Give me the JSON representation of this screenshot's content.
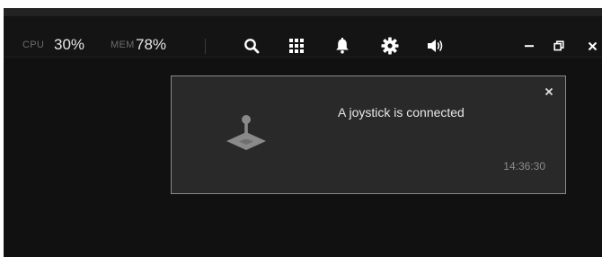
{
  "stats": {
    "cpu_label": "CPU",
    "cpu_value": "30%",
    "mem_label": "MEM",
    "mem_value": "78%"
  },
  "toolbar": {
    "icons": [
      "search-icon",
      "apps-grid-icon",
      "bell-icon",
      "gear-icon",
      "volume-icon"
    ]
  },
  "window_controls": [
    "minimize-icon",
    "restore-icon",
    "close-icon"
  ],
  "notification": {
    "message": "A joystick is connected",
    "time": "14:36:30",
    "icon": "joystick-icon"
  },
  "colors": {
    "background": "#111111",
    "panel": "#292929",
    "border": "#8a8a8a",
    "text": "#e8e8e8",
    "muted": "#8c8c8c"
  }
}
